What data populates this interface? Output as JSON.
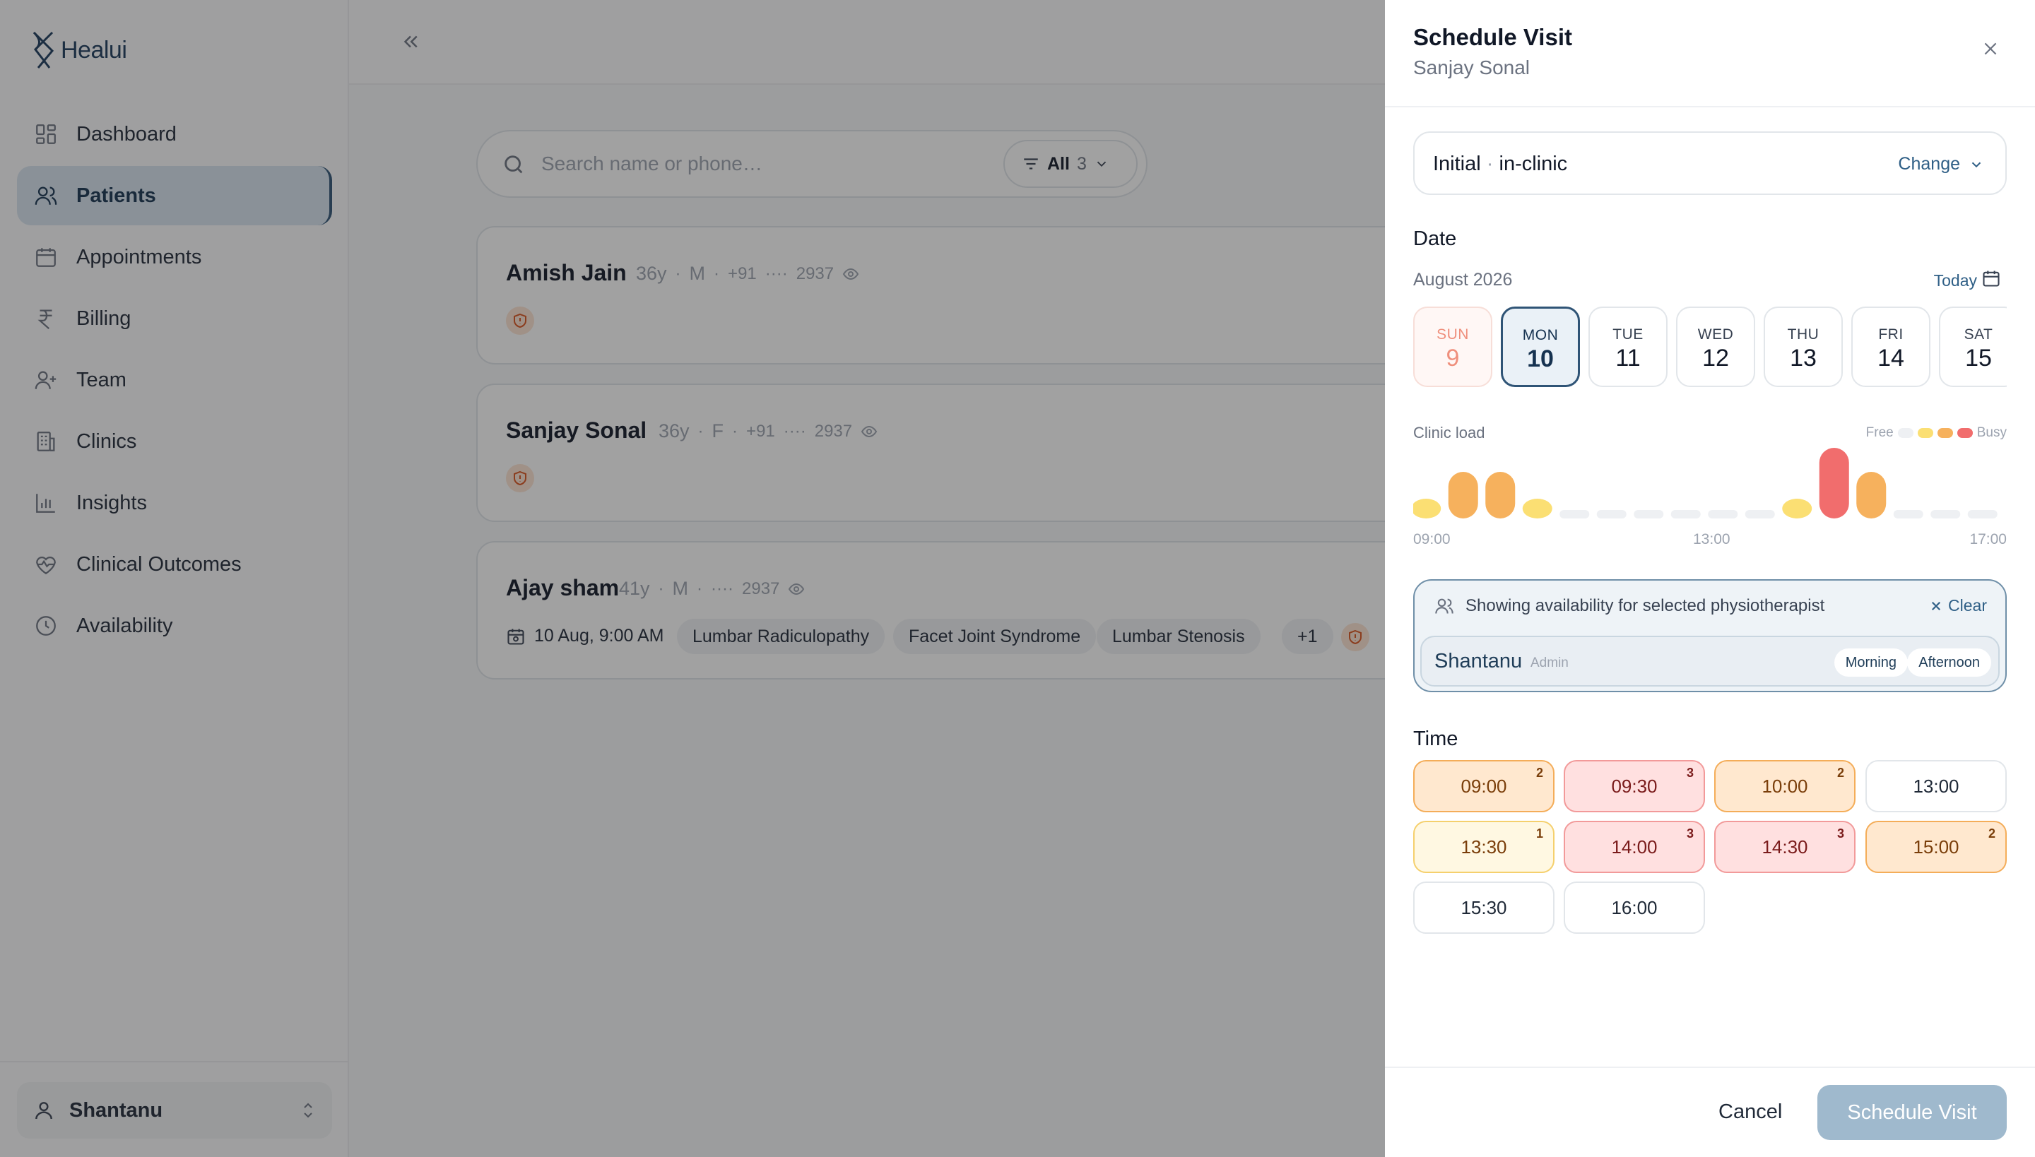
{
  "app": {
    "name": "Healui"
  },
  "sidebar": {
    "items": [
      {
        "label": "Dashboard",
        "icon": "grid-icon"
      },
      {
        "label": "Patients",
        "icon": "users-icon",
        "active": true
      },
      {
        "label": "Appointments",
        "icon": "calendar-icon"
      },
      {
        "label": "Billing",
        "icon": "rupee-icon"
      },
      {
        "label": "Team",
        "icon": "user-plus-icon"
      },
      {
        "label": "Clinics",
        "icon": "building-icon"
      },
      {
        "label": "Insights",
        "icon": "bar-chart-icon"
      },
      {
        "label": "Clinical Outcomes",
        "icon": "heart-pulse-icon"
      },
      {
        "label": "Availability",
        "icon": "clock-icon"
      }
    ],
    "user": {
      "name": "Shantanu"
    }
  },
  "main": {
    "search": {
      "placeholder": "Search name or phone…"
    },
    "filter": {
      "label": "All",
      "count": "3"
    },
    "patients": [
      {
        "name": "Amish Jain",
        "age": "36y",
        "sex": "M",
        "phone_prefix": "+91",
        "phone_mask": "····",
        "phone_last": "2937"
      },
      {
        "name": "Sanjay Sonal",
        "age": "36y",
        "sex": "F",
        "phone_prefix": "+91",
        "phone_mask": "····",
        "phone_last": "2937"
      },
      {
        "name": "Ajay sham",
        "age": "41y",
        "sex": "M",
        "phone_mask": "····",
        "phone_last": "2937",
        "appointment": "10 Aug, 9:00 AM",
        "tags": [
          "Lumbar Radiculopathy",
          "Facet Joint Syndrome",
          "Lumbar Stenosis",
          "+1"
        ]
      }
    ]
  },
  "drawer": {
    "title": "Schedule Visit",
    "subtitle": "Sanjay Sonal",
    "visit_type": {
      "kind": "Initial",
      "separator": "·",
      "mode": "in-clinic",
      "change_label": "Change"
    },
    "date_label": "Date",
    "month": "August 2026",
    "today_label": "Today",
    "days": [
      {
        "name": "SUN",
        "num": "9"
      },
      {
        "name": "MON",
        "num": "10"
      },
      {
        "name": "TUE",
        "num": "11"
      },
      {
        "name": "WED",
        "num": "12"
      },
      {
        "name": "THU",
        "num": "13"
      },
      {
        "name": "FRI",
        "num": "14"
      },
      {
        "name": "SAT",
        "num": "15"
      }
    ],
    "clinic_load": {
      "label": "Clinic load",
      "legend_free": "Free",
      "legend_busy": "Busy",
      "axis": [
        "09:00",
        "13:00",
        "17:00"
      ],
      "levels": [
        1,
        2,
        2,
        1,
        0,
        0,
        0,
        0,
        0,
        0,
        1,
        3,
        2,
        0,
        0,
        0
      ],
      "colors": {
        "empty": "#eef0f3",
        "low": "#fbdf73",
        "mid": "#f6b15d",
        "high": "#f16d6d"
      }
    },
    "physio": {
      "heading": "Showing availability for selected physiotherapist",
      "clear_label": "Clear",
      "name": "Shantanu",
      "role": "Admin",
      "shifts": [
        "Morning",
        "Afternoon"
      ]
    },
    "time_label": "Time",
    "slots": [
      {
        "time": "09:00",
        "count": "2"
      },
      {
        "time": "09:30",
        "count": "3"
      },
      {
        "time": "10:00",
        "count": "2"
      },
      {
        "time": "13:00",
        "count": ""
      },
      {
        "time": "13:30",
        "count": "1"
      },
      {
        "time": "14:00",
        "count": "3"
      },
      {
        "time": "14:30",
        "count": "3"
      },
      {
        "time": "15:00",
        "count": "2"
      },
      {
        "time": "15:30",
        "count": ""
      },
      {
        "time": "16:00",
        "count": ""
      }
    ],
    "cancel_label": "Cancel",
    "submit_label": "Schedule Visit"
  },
  "colors": {
    "brand": "#2f5476",
    "accent_link": "#2f5f86",
    "submit_disabled": "#9fb9cd"
  }
}
